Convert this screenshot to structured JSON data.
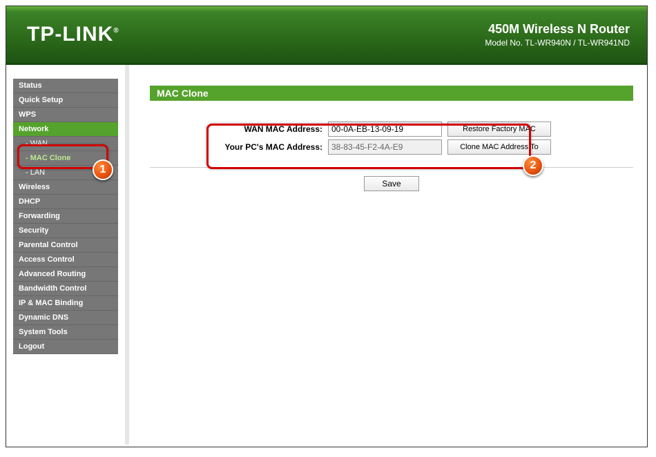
{
  "header": {
    "brand": "TP-LINK",
    "product_line": "450M Wireless N Router",
    "model_label": "Model No. TL-WR940N / TL-WR941ND"
  },
  "sidebar": {
    "items": [
      {
        "label": "Status",
        "type": "item",
        "active": false
      },
      {
        "label": "Quick Setup",
        "type": "item",
        "active": false
      },
      {
        "label": "WPS",
        "type": "item",
        "active": false
      },
      {
        "label": "Network",
        "type": "item",
        "active": true
      },
      {
        "label": "- WAN",
        "type": "sub",
        "active": false
      },
      {
        "label": "- MAC Clone",
        "type": "sub",
        "active": true
      },
      {
        "label": "- LAN",
        "type": "sub",
        "active": false
      },
      {
        "label": "Wireless",
        "type": "item",
        "active": false
      },
      {
        "label": "DHCP",
        "type": "item",
        "active": false
      },
      {
        "label": "Forwarding",
        "type": "item",
        "active": false
      },
      {
        "label": "Security",
        "type": "item",
        "active": false
      },
      {
        "label": "Parental Control",
        "type": "item",
        "active": false
      },
      {
        "label": "Access Control",
        "type": "item",
        "active": false
      },
      {
        "label": "Advanced Routing",
        "type": "item",
        "active": false
      },
      {
        "label": "Bandwidth Control",
        "type": "item",
        "active": false
      },
      {
        "label": "IP & MAC Binding",
        "type": "item",
        "active": false
      },
      {
        "label": "Dynamic DNS",
        "type": "item",
        "active": false
      },
      {
        "label": "System Tools",
        "type": "item",
        "active": false
      },
      {
        "label": "Logout",
        "type": "item",
        "active": false
      }
    ]
  },
  "page": {
    "title": "MAC Clone",
    "wan_mac_label": "WAN MAC Address:",
    "wan_mac_value": "00-0A-EB-13-09-19",
    "restore_btn": "Restore Factory MAC",
    "pc_mac_label": "Your PC's MAC Address:",
    "pc_mac_value": "38-83-45-F2-4A-E9",
    "clone_btn": "Clone MAC Address To",
    "save_btn": "Save"
  },
  "annotations": {
    "badge1": "1",
    "badge2": "2"
  }
}
